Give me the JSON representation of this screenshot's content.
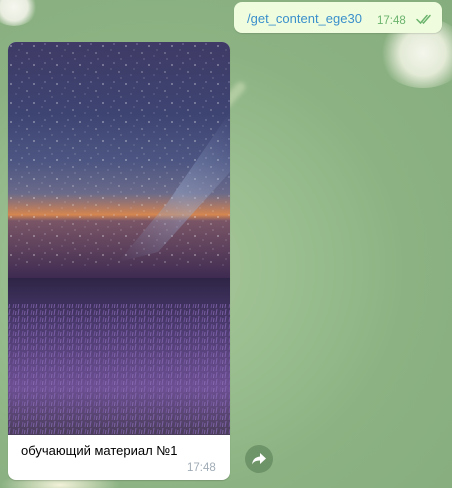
{
  "outgoing_message": {
    "text": "/get_content_ege30",
    "time": "17:48",
    "status_icon": "double-check-icon"
  },
  "incoming_message": {
    "image_subject": "starry night sky over lavender field",
    "caption": "обучающий материал №1",
    "time": "17:48"
  },
  "forward_button": {
    "icon": "forward-arrow-icon"
  },
  "colors": {
    "outgoing_bubble": "#effdde",
    "command_link": "#3a8fcc",
    "outgoing_time": "#6cb36e",
    "incoming_time": "#a0acb6"
  }
}
